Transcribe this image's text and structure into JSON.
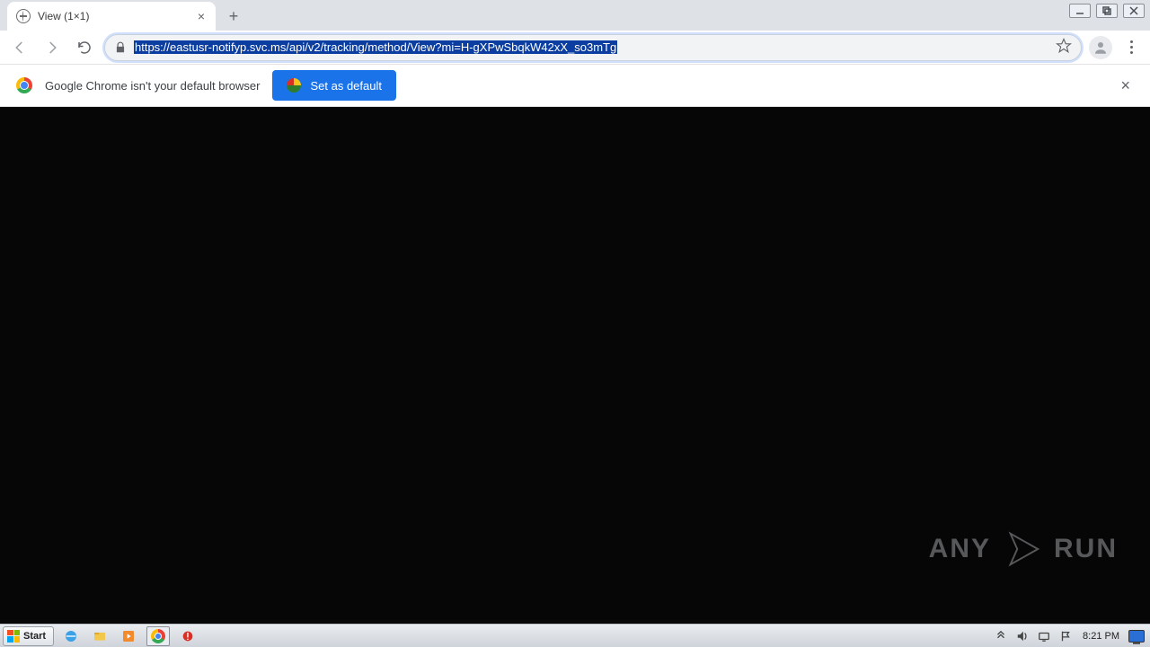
{
  "tab": {
    "title": "View (1×1)"
  },
  "url": "https://eastusr-notifyp.svc.ms/api/v2/tracking/method/View?mi=H-gXPwSbqkW42xX_so3mTg",
  "infobar": {
    "message": "Google Chrome isn't your default browser",
    "button": "Set as default"
  },
  "watermark": {
    "left": "ANY",
    "right": "RUN"
  },
  "taskbar": {
    "start": "Start",
    "clock": "8:21 PM"
  }
}
